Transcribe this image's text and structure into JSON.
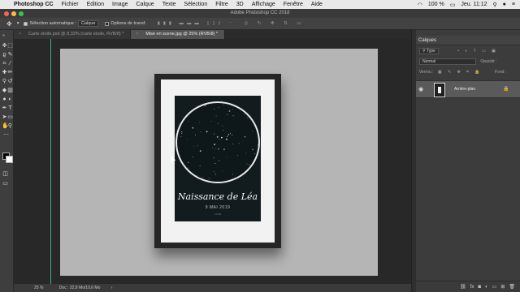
{
  "menubar": {
    "app_name": "Photoshop CC",
    "items": [
      "Fichier",
      "Edition",
      "Image",
      "Calque",
      "Texte",
      "Sélection",
      "Filtre",
      "3D",
      "Affichage",
      "Fenêtre",
      "Aide"
    ],
    "battery": "100 %",
    "clock": "Jeu. 11:12"
  },
  "window": {
    "title": "Adobe Photoshop CC 2018"
  },
  "options": {
    "auto_select_label": "Sélection automatique :",
    "auto_select_value": "Calque",
    "transform_label": "Options de transf."
  },
  "tabs": [
    {
      "label": "Carte etoile.psd @ 8,33% (carte etoile, RVB/8) *"
    },
    {
      "label": "Mise en scene.jpg @ 25% (RVB/8) *"
    }
  ],
  "poster": {
    "title": "Naissance de Léa",
    "date": "9 MAI 2019",
    "city": "LYON"
  },
  "status": {
    "zoom": "25 %",
    "doc": "Doc : 22,8 Mo/10,6 Mo"
  },
  "layers_panel": {
    "title": "Calques",
    "filter": "Type",
    "blend_mode": "Normal",
    "opacity_label": "Opacité :",
    "lock_label": "Verrou :",
    "fill_label": "Fond :",
    "layer_name": "Arrière-plan"
  },
  "colors": {
    "accent": "#2d8ceb",
    "artboard": "#b5b5b5",
    "poster_bg": "#121c1f"
  }
}
